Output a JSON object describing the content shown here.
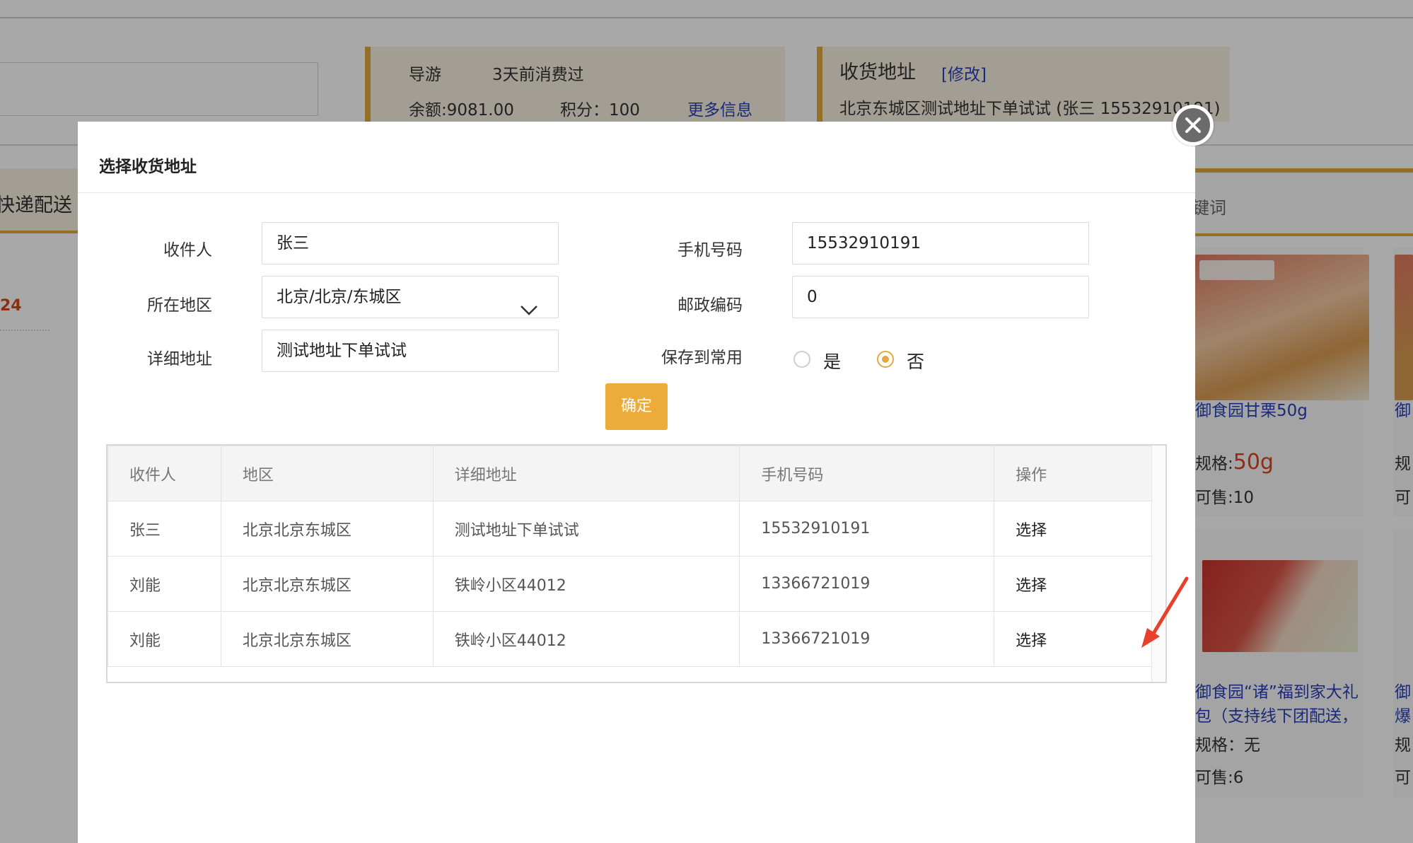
{
  "background": {
    "card1": {
      "role": "导游",
      "last_purchase": "3天前消费过",
      "balance": "余额:9081.00",
      "points": "积分：100",
      "more_link": "更多信息"
    },
    "card2": {
      "title": "收货地址",
      "edit_link": "[修改]",
      "address": "北京东城区测试地址下单试试 (张三 15532910191)"
    },
    "left_tab": "快递配送",
    "left_value": "24",
    "right_tab": "键词",
    "products": [
      {
        "name": "御食园甘栗50g",
        "spec_label": "规格:",
        "spec_value": "50g",
        "stock": "可售:10"
      },
      {
        "name": "御食园“诸”福到家大礼包（支持线下团配送，",
        "spec": "规格：无",
        "stock": "可售:6"
      }
    ],
    "partial_products": [
      {
        "name": "御",
        "spec": "规",
        "stock": "可"
      },
      {
        "name": "御\n爆",
        "spec": "规",
        "stock": "可"
      }
    ]
  },
  "modal": {
    "title": "选择收货地址",
    "form": {
      "recipient_label": "收件人",
      "recipient_value": "张三",
      "phone_label": "手机号码",
      "phone_value": "15532910191",
      "region_label": "所在地区",
      "region_value": "北京/北京/东城区",
      "zip_label": "邮政编码",
      "zip_value": "0",
      "address_label": "详细地址",
      "address_value": "测试地址下单试试",
      "save_label": "保存到常用",
      "save_yes": "是",
      "save_no": "否",
      "save_selected": "否"
    },
    "confirm_label": "确定",
    "table": {
      "headers": [
        "收件人",
        "地区",
        "详细地址",
        "手机号码",
        "操作"
      ],
      "rows": [
        [
          "张三",
          "北京北京东城区",
          "测试地址下单试试",
          "15532910191",
          "选择"
        ],
        [
          "刘能",
          "北京北京东城区",
          "铁岭小区44012",
          "13366721019",
          "选择"
        ],
        [
          "刘能",
          "北京北京东城区",
          "铁岭小区44012",
          "13366721019",
          "选择"
        ]
      ]
    }
  },
  "colors": {
    "accent": "#e3a93e",
    "confirm_button": "#ecab3a",
    "link": "#2a3fb8",
    "price_red": "#d9431f",
    "arrow_red": "#e8402b"
  },
  "icons": [
    "close-icon",
    "chevron-down-icon",
    "arrow-annotation-icon"
  ]
}
